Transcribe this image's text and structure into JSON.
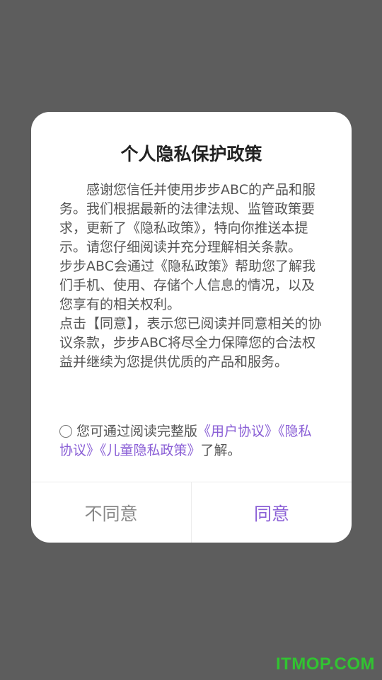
{
  "dialog": {
    "title": "个人隐私保护政策",
    "paragraphs": [
      "感谢您信任并使用步步ABC的产品和服务。我们根据最新的法律法规、监管政策要求，更新了《隐私政策》，特向你推送本提示。请您仔细阅读并充分理解相关条款。",
      "步步ABC会通过《隐私政策》帮助您了解我们手机、使用、存储个人信息的情况，以及您享有的相关权利。",
      "点击【同意】，表示您已阅读并同意相关的协议条款，步步ABC将尽全力保障您的合法权益并继续为您提供优质的产品和服务。"
    ],
    "agreement": {
      "prefix": "您可通过阅读完整版",
      "link_user": "《用户协议》",
      "link_privacy": "《隐私协议》",
      "link_child": "《儿童隐私政策》",
      "suffix": "了解。"
    },
    "buttons": {
      "disagree": "不同意",
      "agree": "同意"
    }
  },
  "watermark": "ITMOP.COM",
  "colors": {
    "overlay": "#5d5d5d",
    "accent": "#8a5fd6",
    "watermark": "#31c431"
  }
}
